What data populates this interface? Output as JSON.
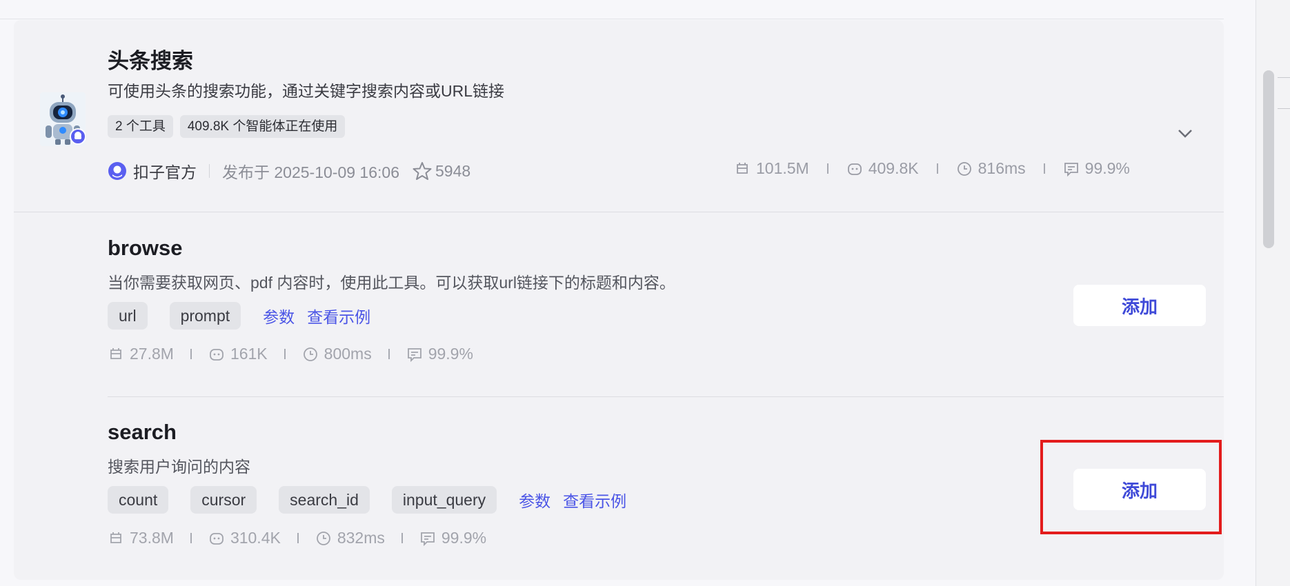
{
  "plugin": {
    "title": "头条搜索",
    "description": "可使用头条的搜索功能，通过关键字搜索内容或URL链接",
    "tags": [
      "2 个工具",
      "409.8K 个智能体正在使用"
    ],
    "author": "扣子官方",
    "published": "发布于 2025-10-09 16:06",
    "stars": "5948",
    "stats": {
      "calls": "101.5M",
      "bots": "409.8K",
      "latency": "816ms",
      "success": "99.9%"
    }
  },
  "tools": [
    {
      "name": "browse",
      "description": "当你需要获取网页、pdf 内容时，使用此工具。可以获取url链接下的标题和内容。",
      "params": [
        "url",
        "prompt"
      ],
      "links": {
        "params": "参数",
        "example": "查看示例"
      },
      "stats": {
        "calls": "27.8M",
        "bots": "161K",
        "latency": "800ms",
        "success": "99.9%"
      },
      "add_label": "添加"
    },
    {
      "name": "search",
      "description": "搜索用户询问的内容",
      "params": [
        "count",
        "cursor",
        "search_id",
        "input_query"
      ],
      "links": {
        "params": "参数",
        "example": "查看示例"
      },
      "stats": {
        "calls": "73.8M",
        "bots": "310.4K",
        "latency": "832ms",
        "success": "99.9%"
      },
      "add_label": "添加"
    }
  ],
  "colors": {
    "accent": "#4b55e6",
    "highlight": "#e31c1c",
    "panel": "#f2f2f5"
  }
}
